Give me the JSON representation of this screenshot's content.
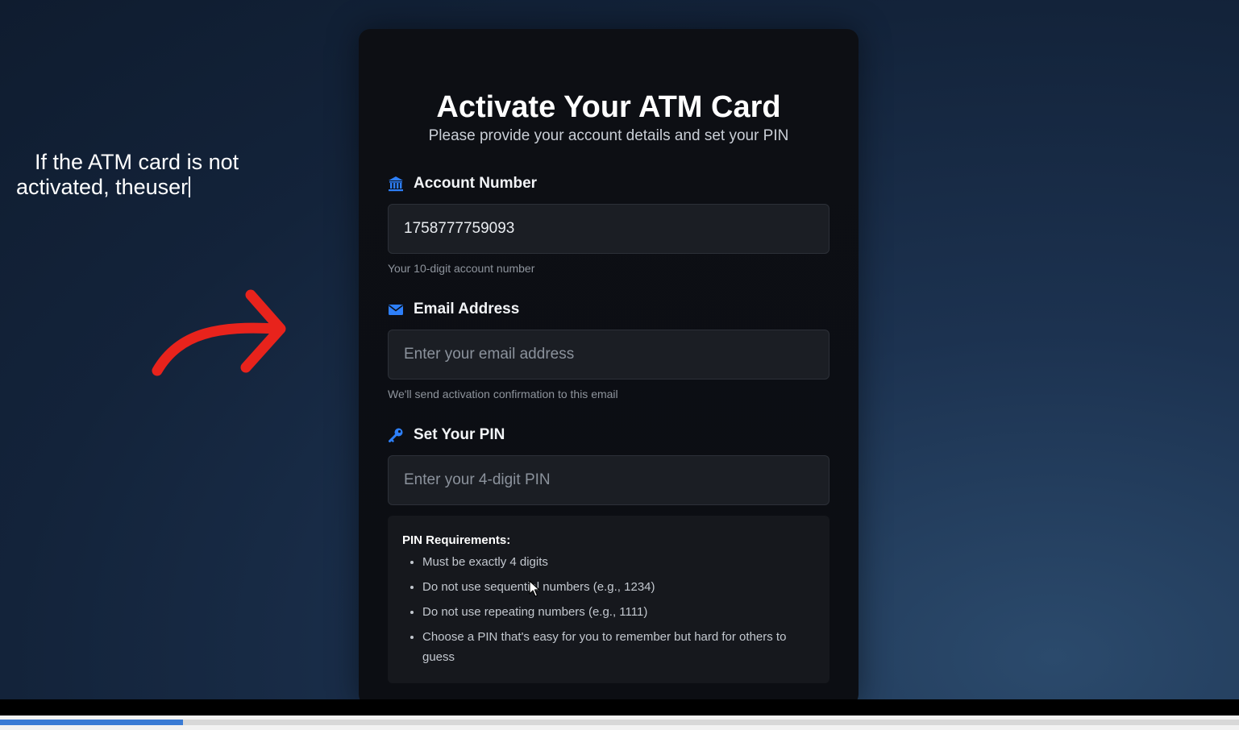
{
  "overlay": {
    "caption_line1": "If the ATM card is not",
    "caption_line2": "activated, theuser",
    "arrow_icon": "curved-arrow-right-icon",
    "arrow_color": "#e8231c"
  },
  "form": {
    "title": "Activate Your ATM Card",
    "subtitle": "Please provide your account details and set your PIN",
    "account_number": {
      "label": "Account Number",
      "icon": "bank-icon",
      "value": "1758777759093",
      "hint": "Your 10-digit account number"
    },
    "email": {
      "label": "Email Address",
      "icon": "envelope-icon",
      "placeholder": "Enter your email address",
      "hint": "We'll send activation confirmation to this email"
    },
    "pin": {
      "label": "Set Your PIN",
      "icon": "key-icon",
      "placeholder": "Enter your 4-digit PIN"
    },
    "requirements": {
      "title": "PIN Requirements:",
      "items": [
        "Must be exactly 4 digits",
        "Do not use sequential numbers (e.g., 1234)",
        "Do not use repeating numbers (e.g., 1111)",
        "Choose a PIN that's easy for you to remember but hard for others to guess"
      ]
    },
    "accent_color": "#2d7ff9"
  },
  "video": {
    "progress_fraction": 0.148,
    "progress_color": "#3a7bd5"
  }
}
